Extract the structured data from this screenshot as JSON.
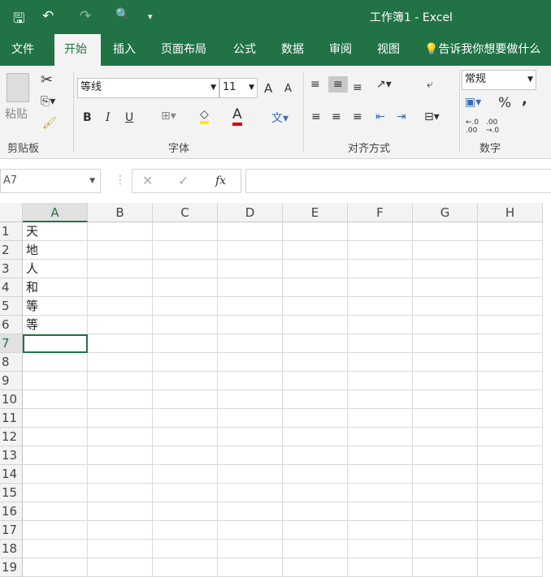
{
  "title": "工作簿1  -  Excel",
  "qat": {
    "save": "🖫",
    "undo": "↶",
    "redo": "↷",
    "preview": "🔍",
    "customize": "▾"
  },
  "tabs": [
    "文件",
    "开始",
    "插入",
    "页面布局",
    "公式",
    "数据",
    "审阅",
    "视图"
  ],
  "tell_me": "告诉我你想要做什么",
  "ribbon": {
    "paste": "粘贴",
    "font_name": "等线",
    "font_size": "11",
    "number_format": "常规",
    "groups": [
      "剪贴板",
      "字体",
      "对齐方式",
      "数字"
    ],
    "bold": "B",
    "italic": "I",
    "underline": "U",
    "percent": "%",
    "comma": ",",
    "grow": "A",
    "shrink": "A",
    "fx": "fx"
  },
  "name_box": "A7",
  "formula": "",
  "columns": [
    "A",
    "B",
    "C",
    "D",
    "E",
    "F",
    "G",
    "H"
  ],
  "rows": [
    "1",
    "2",
    "3",
    "4",
    "5",
    "6",
    "7",
    "8",
    "9",
    "10",
    "11",
    "12",
    "13",
    "14",
    "15",
    "16",
    "17",
    "18",
    "19"
  ],
  "cells": [
    "天",
    "地",
    "人",
    "和",
    "等",
    "等"
  ],
  "colors": {
    "accent": "#217346"
  }
}
